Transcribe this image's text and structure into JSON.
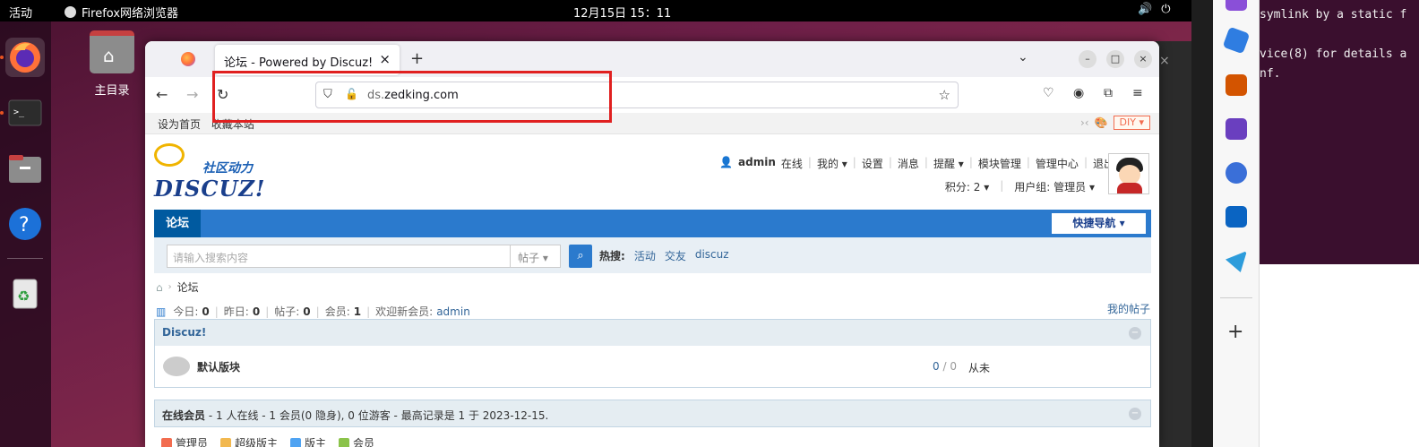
{
  "topbar": {
    "activities": "活动",
    "app_name": "Firefox网络浏览器",
    "clock": "12月15日  15：11",
    "tray_icons": [
      "volume-icon",
      "power-icon"
    ]
  },
  "dock": {
    "items": [
      "firefox-icon",
      "terminal-icon",
      "files-icon",
      "help-icon",
      "trash-icon"
    ]
  },
  "desktop": {
    "home_label": "主目录"
  },
  "firefox": {
    "tab_title": "论坛 - Powered by Discuz!",
    "tab_close": "×",
    "new_tab": "+",
    "url_sub": "ds.",
    "url_domain": "zedking.com"
  },
  "discuz": {
    "topnav": {
      "set_home": "设为首页",
      "bookmark": "收藏本站",
      "diy": "DIY ▾"
    },
    "user": {
      "name": "admin",
      "status": "在线",
      "my": "我的 ▾",
      "settings": "设置",
      "messages": "消息",
      "reminders": "提醒 ▾",
      "module_admin": "模块管理",
      "admin_center": "管理中心",
      "logout": "退出",
      "points": "积分: 2 ▾",
      "group": "用户组: 管理员 ▾"
    },
    "logo": {
      "tagline": "社区动力",
      "word": "DISCUZ!"
    },
    "nav": {
      "home": "论坛",
      "quick_nav": "快捷导航 ▾"
    },
    "search": {
      "placeholder": "请输入搜索内容",
      "type": "帖子 ▾",
      "hot_label": "热搜:",
      "hot_terms": [
        "活动",
        "交友",
        "discuz"
      ]
    },
    "breadcrumb": {
      "current": "论坛"
    },
    "stats": {
      "today_label": "今日:",
      "today": "0",
      "yesterday_label": "昨日:",
      "yesterday": "0",
      "posts_label": "帖子:",
      "posts": "0",
      "members_label": "会员:",
      "members": "1",
      "welcome_label": "欢迎新会员:",
      "newest": "admin",
      "my_threads": "我的帖子"
    },
    "category": {
      "title": "Discuz!"
    },
    "forum": {
      "name": "默认版块",
      "threads": "0",
      "posts": "0",
      "last_post": "从未"
    },
    "online": {
      "title": "在线会员",
      "detail": "- 1 人在线 - 1 会员(0 隐身), 0 位游客 - 最高记录是 1 于 2023-12-15.",
      "legend": [
        {
          "label": "管理员",
          "color": "#f26c4f"
        },
        {
          "label": "超级版主",
          "color": "#f2b84f"
        },
        {
          "label": "版主",
          "color": "#4fa3f2"
        },
        {
          "label": "会员",
          "color": "#8bc34a"
        }
      ]
    }
  },
  "terminal": {
    "lines": [
      "symlink by a static f",
      "",
      "vice(8) for details a",
      "nf."
    ]
  }
}
